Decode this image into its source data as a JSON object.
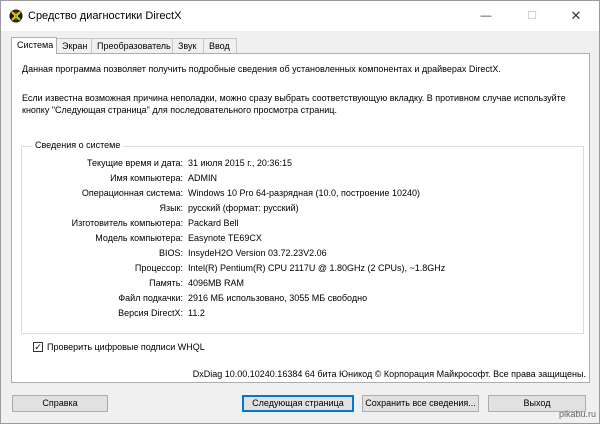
{
  "window": {
    "title": "Средство диагностики DirectX",
    "minimize_glyph": "—",
    "maximize_glyph": "☐",
    "close_glyph": "✕"
  },
  "tabs": [
    {
      "label": "Система",
      "active": true
    },
    {
      "label": "Экран",
      "active": false
    },
    {
      "label": "Преобразователь",
      "active": false
    },
    {
      "label": "Звук",
      "active": false
    },
    {
      "label": "Ввод",
      "active": false
    }
  ],
  "intro": {
    "line1": "Данная программа позволяет получить подробные сведения об установленных компонентах и драйверах DirectX.",
    "line2": "Если известна возможная причина неполадки, можно сразу выбрать соответствующую вкладку. В противном случае используйте кнопку \"Следующая страница\" для последовательного просмотра страниц."
  },
  "system_info": {
    "group_title": "Сведения о системе",
    "rows": [
      {
        "label": "Текущие время и дата:",
        "value": "31 июля 2015 г., 20:36:15"
      },
      {
        "label": "Имя компьютера:",
        "value": "ADMIN"
      },
      {
        "label": "Операционная система:",
        "value": "Windows 10 Pro 64-разрядная (10.0, построение 10240)"
      },
      {
        "label": "Язык:",
        "value": "русский (формат: русский)"
      },
      {
        "label": "Изготовитель компьютера:",
        "value": "Packard Bell"
      },
      {
        "label": "Модель компьютера:",
        "value": "Easynote TE69CX"
      },
      {
        "label": "BIOS:",
        "value": "InsydeH2O Version 03.72.23V2.06"
      },
      {
        "label": "Процессор:",
        "value": "Intel(R) Pentium(R) CPU 2117U @ 1.80GHz (2 CPUs), ~1.8GHz"
      },
      {
        "label": "Память:",
        "value": "4096MB RAM"
      },
      {
        "label": "Файл подкачки:",
        "value": "2916 МБ использовано, 3055 МБ свободно"
      },
      {
        "label": "Версия DirectX:",
        "value": "11.2"
      }
    ]
  },
  "whql": {
    "label": "Проверить цифровые подписи WHQL",
    "checked": true,
    "check_glyph": "✓"
  },
  "copyright": "DxDiag 10.00.10240.16384 64 бита Юникод © Корпорация Майкрософт. Все права защищены.",
  "buttons": {
    "help": "Справка",
    "next": "Следующая страница",
    "save": "Сохранить все сведения...",
    "exit": "Выход"
  },
  "watermark": "pikabu.ru",
  "colors": {
    "accent": "#0078d7",
    "panel_bg": "#ffffff",
    "window_bg": "#f0f0f0"
  }
}
